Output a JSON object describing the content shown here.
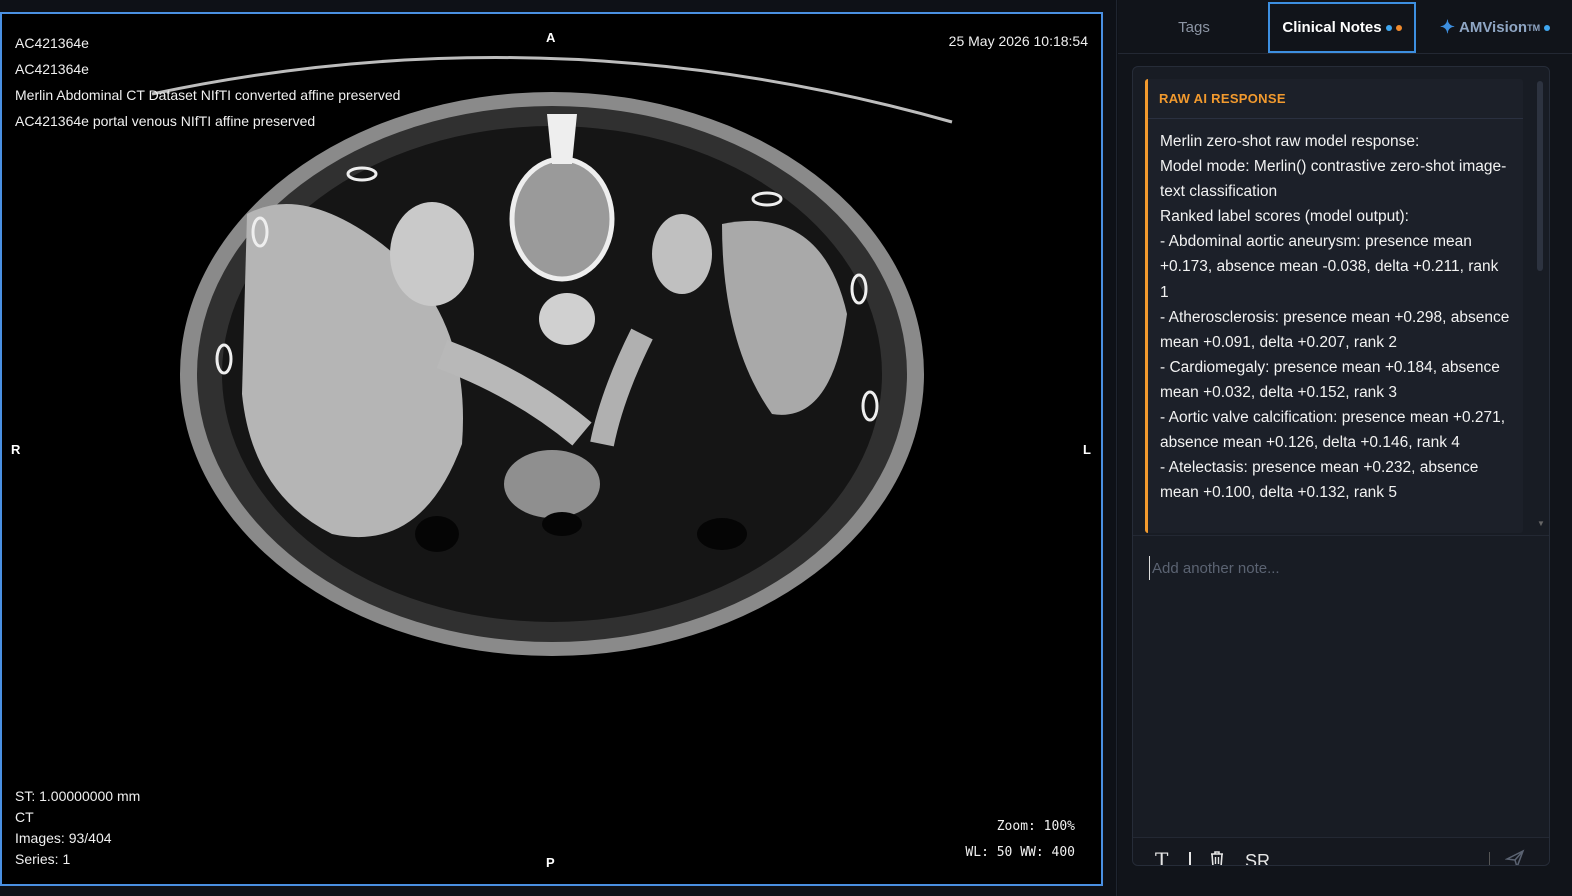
{
  "viewer": {
    "overlay_top_left": [
      "AC421364e",
      "AC421364e",
      "Merlin Abdominal CT Dataset NIfTI converted affine preserved",
      "AC421364e portal venous NIfTI affine preserved"
    ],
    "timestamp": "25 May 2026 10:18:54",
    "slice_thickness": "ST: 1.00000000 mm",
    "modality": "CT",
    "images": "Images: 93/404",
    "series": "Series: 1",
    "zoom": "Zoom: 100%",
    "window": "WL: 50 WW: 400",
    "orientation": {
      "anterior": "A",
      "posterior": "P",
      "right": "R",
      "left": "L"
    }
  },
  "tabs": {
    "tags": "Tags",
    "clinical_notes": "Clinical Notes",
    "amvision": "AMVision",
    "amvision_mark": "TM"
  },
  "notes": {
    "header": "RAW AI RESPONSE",
    "lines": [
      "Merlin zero-shot raw model response:",
      "Model mode: Merlin() contrastive zero-shot image-text classification",
      "Ranked label scores (model output):",
      "- Abdominal aortic aneurysm: presence mean +0.173, absence mean -0.038, delta +0.211, rank 1",
      "- Atherosclerosis: presence mean +0.298, absence mean +0.091, delta +0.207, rank 2",
      "- Cardiomegaly: presence mean +0.184, absence mean +0.032, delta +0.152, rank 3",
      "- Aortic valve calcification: presence mean +0.271, absence mean +0.126, delta +0.146, rank 4",
      "- Atelectasis: presence mean +0.232, absence mean +0.100, delta +0.132, rank 5"
    ],
    "input_placeholder": "Add another note...",
    "toolbar_sr": "SR"
  },
  "colors": {
    "accent": "#3d8fe0",
    "response_accent": "#f29a2e",
    "dot_orange": "#f08a2c"
  },
  "icons": {
    "text": "text-format-icon",
    "trash": "trash-icon",
    "send": "send-icon",
    "sparkle": "sparkle-icon",
    "collapse": "chevron-left-icon"
  }
}
